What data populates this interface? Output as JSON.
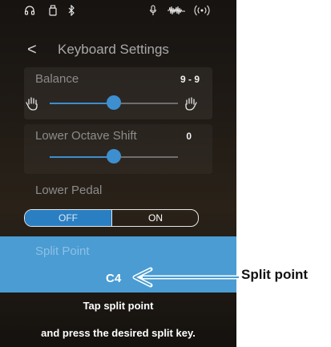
{
  "status_bar": {
    "icons": [
      "headphones-icon",
      "usb-memory-icon",
      "bluetooth-icon",
      "microphone-icon",
      "audio-wave-icon",
      "wireless-icon"
    ]
  },
  "header": {
    "back_glyph": "<",
    "title": "Keyboard Settings"
  },
  "balance": {
    "label": "Balance",
    "value": "9 - 9",
    "slider_level": 0.5
  },
  "octave": {
    "label": "Lower Octave Shift",
    "value": "0",
    "slider_level": 0.5
  },
  "pedal": {
    "label": "Lower Pedal",
    "off_label": "OFF",
    "on_label": "ON",
    "selected": "OFF"
  },
  "split": {
    "label": "Split Point",
    "note": "C4"
  },
  "instructions": {
    "line1": "Tap split point",
    "line2": "and press the desired split key."
  },
  "annotation": {
    "label": "Split point"
  },
  "colors": {
    "accent": "#3d8fcf",
    "split_bg": "#4a9cd3",
    "toggle_selected": "#2a7fc2"
  }
}
